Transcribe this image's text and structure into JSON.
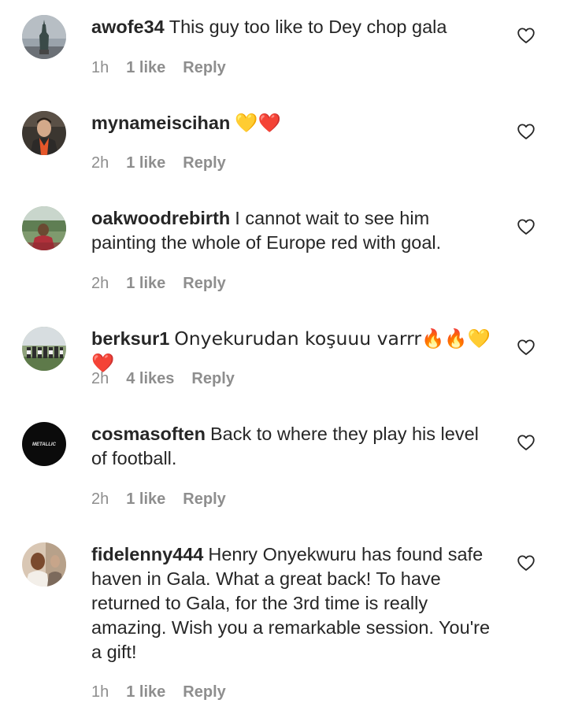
{
  "comments": [
    {
      "username": "awofe34",
      "text": "This guy too like to Dey chop gala",
      "time": "1h",
      "likes": "1 like",
      "reply": "Reply"
    },
    {
      "username": "mynameiscihan",
      "text": "💛❤️",
      "time": "2h",
      "likes": "1 like",
      "reply": "Reply"
    },
    {
      "username": "oakwoodrebirth",
      "text": "I cannot wait to see him painting the whole of Europe red with goal.",
      "time": "2h",
      "likes": "1 like",
      "reply": "Reply"
    },
    {
      "username": "berksur1",
      "text": "Onyekurudan koşuuu varrr🔥🔥💛❤️",
      "time": "2h",
      "likes": "4 likes",
      "reply": "Reply"
    },
    {
      "username": "cosmasoften",
      "text": "Back to where they play his level of football.",
      "time": "2h",
      "likes": "1 like",
      "reply": "Reply"
    },
    {
      "username": "fidelenny444",
      "text": "Henry Onyekwuru has found safe haven in Gala. What a great back! To have returned to Gala, for the 3rd time is really amazing. Wish you a remarkable session. You're a gift!",
      "time": "1h",
      "likes": "1 like",
      "reply": "Reply"
    }
  ],
  "avatars": {
    "cosmasoften_logo_text": "METALLIC"
  },
  "icons": {
    "like": "heart-outline-icon"
  },
  "colors": {
    "text": "#262626",
    "meta": "#8e8e8e",
    "background": "#ffffff"
  }
}
